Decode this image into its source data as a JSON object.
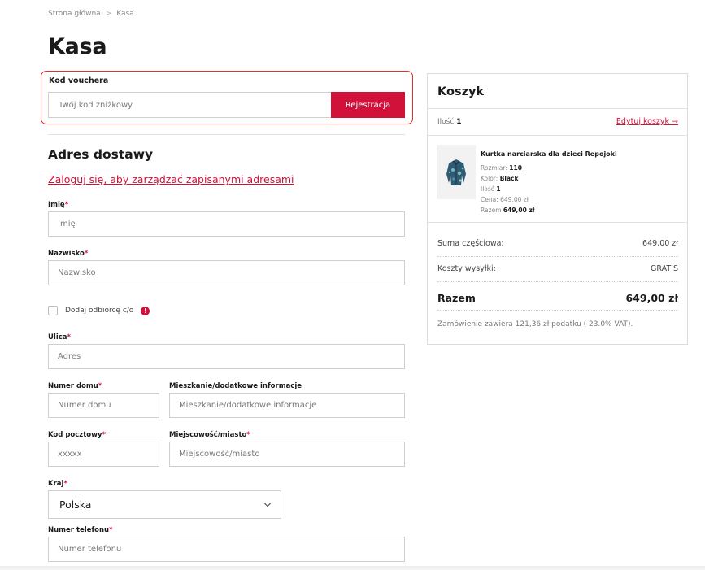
{
  "breadcrumb": {
    "home": "Strona główna",
    "separator": ">",
    "current": "Kasa"
  },
  "page_title": "Kasa",
  "voucher": {
    "label": "Kod vouchera",
    "placeholder": "Twój kod zniżkowy",
    "button": "Rejestracja"
  },
  "address": {
    "title": "Adres dostawy",
    "login_link": "Zaloguj się, aby zarządzać zapisanymi adresami",
    "required_mark": "*",
    "fields": {
      "first_name": {
        "label": "Imię",
        "placeholder": "Imię"
      },
      "last_name": {
        "label": "Nazwisko",
        "placeholder": "Nazwisko"
      },
      "street": {
        "label": "Ulica",
        "placeholder": "Adres"
      },
      "house_number": {
        "label": "Numer domu",
        "placeholder": "Numer domu"
      },
      "apartment": {
        "label": "Mieszkanie/dodatkowe informacje",
        "placeholder": "Mieszkanie/dodatkowe informacje"
      },
      "postal_code": {
        "label": "Kod pocztowy",
        "placeholder": "xxxxx"
      },
      "city": {
        "label": "Miejscowość/miasto",
        "placeholder": "Miejscowość/miasto"
      },
      "country": {
        "label": "Kraj",
        "value": "Polska"
      },
      "phone": {
        "label": "Numer telefonu",
        "placeholder": "Numer telefonu"
      }
    },
    "co_checkbox": {
      "label": "Dodaj odbiorcę c/o",
      "info_icon": "!"
    }
  },
  "cart": {
    "title": "Koszyk",
    "qty_label": "Ilość",
    "qty_value": "1",
    "edit_link": "Edytuj koszyk →",
    "product": {
      "name": "Kurtka narciarska dla dzieci Repojoki",
      "size_label": "Rozmiar:",
      "size_value": "110",
      "color_label": "Kolor:",
      "color_value": "Black",
      "qty_label": "Ilość",
      "qty_value": "1",
      "price_label": "Cena:",
      "price_value": "649,00 zł",
      "total_label": "Razem",
      "total_value": "649,00 zł"
    },
    "subtotal_label": "Suma częściowa:",
    "subtotal_value": "649,00 zł",
    "shipping_label": "Koszty wysyłki:",
    "shipping_value": "GRATIS",
    "total_label": "Razem",
    "total_value": "649,00 zł",
    "tax_note": "Zamówienie zawiera 121,36 zł podatku ( 23.0% VAT)."
  },
  "colors": {
    "accent": "#d1113a",
    "highlight_border": "#e0302b"
  }
}
